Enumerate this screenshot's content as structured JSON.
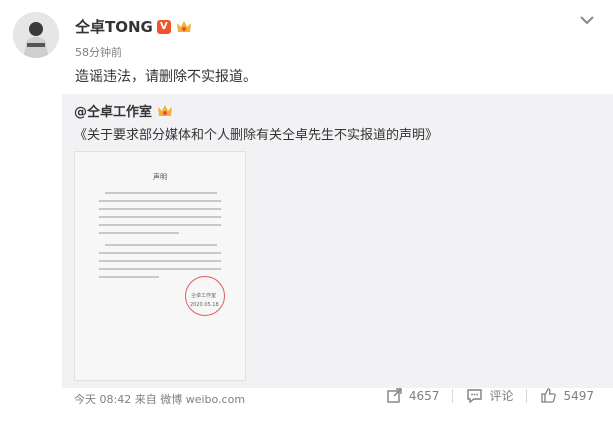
{
  "colors": {
    "page_bg": "#ffffff",
    "repost_bg": "#f2f2f5",
    "text_primary": "#333333",
    "text_secondary": "#808080",
    "verified_badge": "#f0552a"
  },
  "post": {
    "author": "仝卓TONG",
    "verified_icon": "verified-v-icon",
    "member_icon": "crown-badge-icon",
    "time_ago": "58分钟前",
    "text": "造谣违法，请删除不实报道。",
    "menu_icon": "chevron-down-icon"
  },
  "repost": {
    "author": "@仝卓工作室",
    "author_badge_icon": "crown-badge-icon",
    "text": "《关于要求部分媒体和个人删除有关仝卓先生不实报道的声明》",
    "image": {
      "description_icon": "statement-document-image",
      "doc_title": "声明",
      "stamp_text": "仝卓工作室",
      "stamp_date": "2020.05.18"
    },
    "footer": {
      "time": "今天 08:42",
      "from_label": "来自",
      "source": "微博 weibo.com"
    },
    "actions": [
      {
        "name": "repost",
        "icon": "share-icon",
        "count": "4657"
      },
      {
        "name": "comment",
        "icon": "comment-icon",
        "label": "评论"
      },
      {
        "name": "like",
        "icon": "thumbs-up-icon",
        "count": "5497"
      }
    ]
  }
}
